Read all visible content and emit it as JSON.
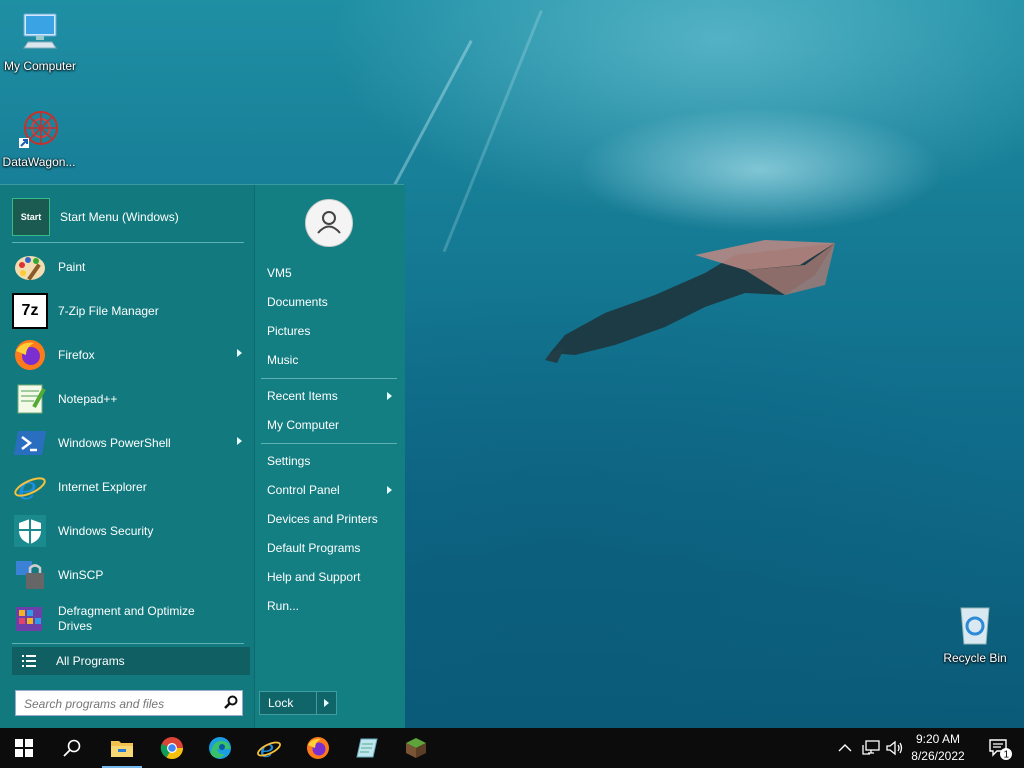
{
  "desktop": {
    "icons": [
      {
        "label": "My Computer",
        "icon": "monitor-icon"
      },
      {
        "label": "DataWagon...",
        "icon": "datawagon-icon"
      },
      {
        "label": "Recycle Bin",
        "icon": "recycle-bin-icon"
      }
    ]
  },
  "start_menu": {
    "pinned": [
      {
        "label": "Start Menu (Windows)",
        "icon": "start-menu-icon",
        "submenu": false
      },
      {
        "label": "Paint",
        "icon": "paint-icon",
        "submenu": false
      },
      {
        "label": "7-Zip File Manager",
        "icon": "7zip-icon",
        "submenu": false
      },
      {
        "label": "Firefox",
        "icon": "firefox-icon",
        "submenu": true
      },
      {
        "label": "Notepad++",
        "icon": "notepadpp-icon",
        "submenu": false
      },
      {
        "label": "Windows PowerShell",
        "icon": "powershell-icon",
        "submenu": true
      },
      {
        "label": "Internet Explorer",
        "icon": "internet-explorer-icon",
        "submenu": false
      },
      {
        "label": "Windows Security",
        "icon": "shield-icon",
        "submenu": false
      },
      {
        "label": "WinSCP",
        "icon": "winscp-icon",
        "submenu": false
      },
      {
        "label": "Defragment and Optimize",
        "label2": "Drives",
        "icon": "defrag-icon",
        "submenu": false
      }
    ],
    "start_icon_text": "Start",
    "sevenzip_icon_text": "7z",
    "all_programs": "All Programs",
    "search_placeholder": "Search programs and files",
    "right": {
      "user": "VM5",
      "documents": "Documents",
      "pictures": "Pictures",
      "music": "Music",
      "recent_items": "Recent Items",
      "my_computer": "My Computer",
      "settings": "Settings",
      "control_panel": "Control Panel",
      "devices_printers": "Devices and Printers",
      "default_programs": "Default Programs",
      "help_support": "Help and Support",
      "run": "Run..."
    },
    "lock": "Lock"
  },
  "taskbar": {
    "buttons": [
      "start-icon",
      "search-icon",
      "file-explorer-icon",
      "chrome-icon",
      "edge-icon",
      "internet-explorer-icon",
      "firefox-icon",
      "notepad-icon",
      "minecraft-icon"
    ],
    "time": "9:20 AM",
    "date": "8/26/2022",
    "notification_count": "1"
  },
  "colors": {
    "menu_bg": "#127a7e",
    "taskbar_bg": "#0c0c0c",
    "accent": "#76b9ed"
  }
}
